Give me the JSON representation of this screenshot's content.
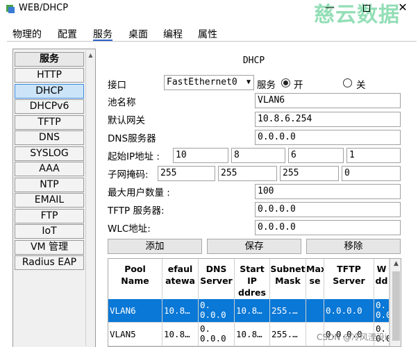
{
  "window": {
    "title": "WEB/DHCP",
    "watermark": "慈云数据"
  },
  "tabs": [
    {
      "label": "物理的"
    },
    {
      "label": "配置"
    },
    {
      "label": "服务"
    },
    {
      "label": "桌面"
    },
    {
      "label": "编程"
    },
    {
      "label": "属性"
    }
  ],
  "services": {
    "header": "服务",
    "items": [
      "HTTP",
      "DHCP",
      "DHCPv6",
      "TFTP",
      "DNS",
      "SYSLOG",
      "AAA",
      "NTP",
      "EMAIL",
      "FTP",
      "IoT",
      "VM 管理",
      "Radius EAP"
    ],
    "selected": "DHCP"
  },
  "dhcp": {
    "panel_title": "DHCP",
    "interface_label": "接口",
    "interface_value": "FastEthernet0",
    "service_label": "服务",
    "on_label": "开",
    "off_label": "关",
    "pool_name_label": "池名称",
    "pool_name_value": "VLAN6",
    "gateway_label": "默认网关",
    "gateway_value": "10.8.6.254",
    "dns_label": "DNS服务器",
    "dns_value": "0.0.0.0",
    "start_ip_label": "起始IP地址 :",
    "start_ip": [
      "10",
      "8",
      "6",
      "1"
    ],
    "mask_label": "子网掩码:",
    "mask": [
      "255",
      "255",
      "255",
      "0"
    ],
    "max_users_label": "最大用户数量 :",
    "max_users_value": "100",
    "tftp_label": "TFTP 服务器:",
    "tftp_value": "0.0.0.0",
    "wlc_label": "WLC地址:",
    "wlc_value": "0.0.0.0",
    "add_button": "添加",
    "save_button": "保存",
    "remove_button": "移除"
  },
  "pool_table": {
    "columns": [
      "Pool\nName",
      "efaul\natewa",
      "DNS\nServer",
      "Start\nIP\nddres",
      "Subnet\nMask",
      "Max\nse",
      "TFTP\nServer",
      "W\ndd"
    ],
    "rows": [
      [
        "VLAN6",
        "10.8…",
        "0.\n0.0.0",
        "10.8…",
        "255.…",
        "",
        "0.0.0.0",
        "0.\n0.0"
      ],
      [
        "VLAN5",
        "10.8…",
        "0.\n0.0.0",
        "10.8…",
        "255.…",
        "",
        "0.0.0.0",
        "0.\n0.0"
      ]
    ],
    "selected_row": 0
  },
  "footer": {
    "csdn": "CSDN @冷风湮没i"
  }
}
